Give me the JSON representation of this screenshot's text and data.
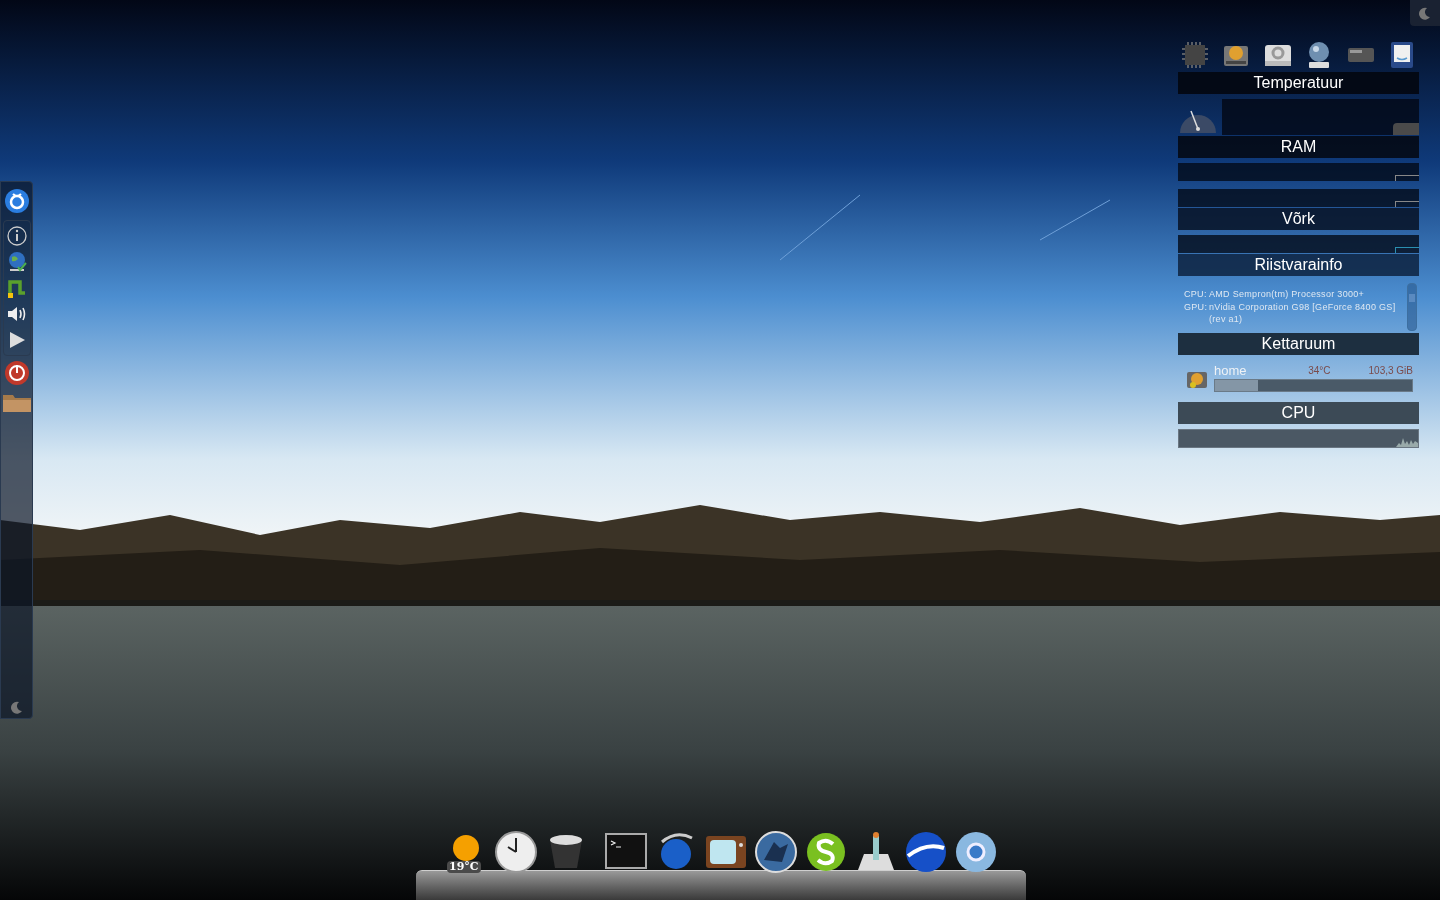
{
  "widget": {
    "sections": [
      {
        "kind": "gauge",
        "title": "Temperatuur"
      },
      {
        "kind": "graphs",
        "title": "RAM"
      },
      {
        "kind": "graph",
        "title": "Võrk"
      },
      {
        "kind": "info",
        "title": "Riistvarainfo",
        "lines": [
          {
            "label": "CPU:",
            "value": "AMD Sempron(tm) Processor 3000+"
          },
          {
            "label": "GPU:",
            "value": "nVidia Corporation G98 [GeForce 8400 GS] (rev a1)"
          }
        ]
      },
      {
        "kind": "disk",
        "title": "Kettaruum",
        "disk": {
          "name": "home",
          "temp": "34°C",
          "size": "103,3 GiB",
          "level": 0.22
        }
      },
      {
        "kind": "cpu",
        "title": "CPU"
      }
    ]
  },
  "dock": {
    "weather": "19°C"
  }
}
